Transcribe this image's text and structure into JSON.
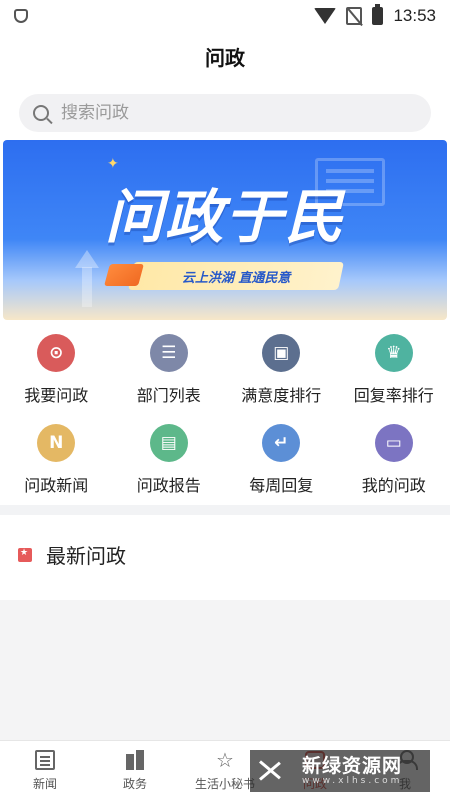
{
  "status_bar": {
    "time": "13:53"
  },
  "header": {
    "title": "问政"
  },
  "search": {
    "placeholder": "搜索问政"
  },
  "banner": {
    "headline": "问政于民",
    "slogan": "云上洪湖 直通民意"
  },
  "grid": {
    "items": [
      {
        "label": "我要问政",
        "icon": "location-pin-icon",
        "glyph": "⊙",
        "color": "#d95b5b"
      },
      {
        "label": "部门列表",
        "icon": "list-icon",
        "glyph": "☰",
        "color": "#7e88a8"
      },
      {
        "label": "满意度排行",
        "icon": "ranking-icon",
        "glyph": "▣",
        "color": "#5c6f8f"
      },
      {
        "label": "回复率排行",
        "icon": "trophy-icon",
        "glyph": "♛",
        "color": "#4fb3a0"
      },
      {
        "label": "问政新闻",
        "icon": "news-n-icon",
        "glyph": "N",
        "color": "#e4b864"
      },
      {
        "label": "问政报告",
        "icon": "document-icon",
        "glyph": "▤",
        "color": "#5db88a"
      },
      {
        "label": "每周回复",
        "icon": "reply-icon",
        "glyph": "↵",
        "color": "#5c8fd6"
      },
      {
        "label": "我的问政",
        "icon": "chat-icon",
        "glyph": "▭",
        "color": "#7c74c2"
      }
    ]
  },
  "latest": {
    "title": "最新问政"
  },
  "nav": {
    "items": [
      {
        "label": "新闻",
        "icon": "newspaper-icon",
        "active": false
      },
      {
        "label": "政务",
        "icon": "building-icon",
        "active": false
      },
      {
        "label": "生活小秘书",
        "icon": "sparkle-icon",
        "active": false
      },
      {
        "label": "问政",
        "icon": "ask-icon",
        "active": true
      },
      {
        "label": "我",
        "icon": "person-icon",
        "active": false
      }
    ]
  },
  "watermark": {
    "main": "新绿资源网",
    "sub": "www.xlhs.com"
  },
  "colors": {
    "accent": "#d9453a",
    "banner_blue": "#2d6ef0"
  }
}
